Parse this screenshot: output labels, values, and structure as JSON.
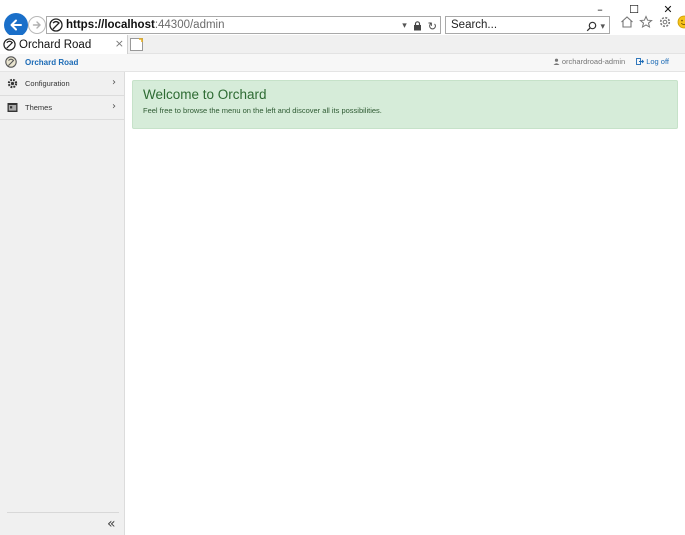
{
  "browser": {
    "address": {
      "protocol_host": "https://localhost",
      "rest": ":44300/admin",
      "dropdown_glyph": "▾",
      "lock_icon": "lock-icon",
      "refresh_glyph": "↻"
    },
    "search": {
      "placeholder": "Search...",
      "glyph": "⌕",
      "dropdown_glyph": "▾"
    },
    "window_controls": {
      "minimize": "–",
      "maximize": "☐",
      "close": "✕"
    },
    "tab": {
      "title": "Orchard Road",
      "close": "×"
    },
    "toolbar_icons": [
      "home-icon",
      "favorites-star-icon",
      "settings-gear-icon",
      "smiley-feedback-icon"
    ]
  },
  "app": {
    "brand_name": "Orchard Road",
    "user": {
      "name": "orchardroad-admin",
      "logoff": "Log off"
    },
    "sidebar": {
      "items": [
        {
          "label": "Configuration",
          "icon": "cog-icon",
          "chevron": "›"
        },
        {
          "label": "Themes",
          "icon": "themes-icon",
          "chevron": "›"
        }
      ],
      "collapse_glyph": "«"
    },
    "welcome": {
      "title": "Welcome to Orchard",
      "text": "Feel free to browse the menu on the left and discover all its possibilities."
    }
  },
  "colors": {
    "accent": "#1c6bb6",
    "back_button": "#1a6fc9",
    "welcome_bg": "#d6ecd9",
    "welcome_title": "#2e6b33"
  }
}
